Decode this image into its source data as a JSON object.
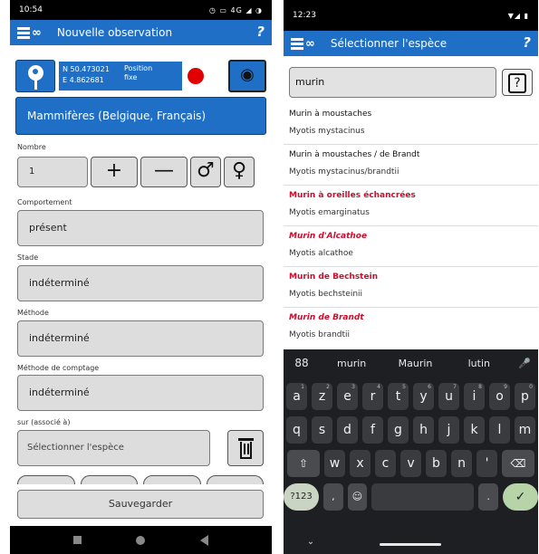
{
  "left": {
    "status": {
      "time": "10:54",
      "icons": "◷ ▭ 4G ◢ ◑"
    },
    "appbar": {
      "title": "Nouvelle observation",
      "help_label": "?"
    },
    "location": {
      "lat": "N 50.473021",
      "lon": "E 4.862681",
      "mode_line1": "Position",
      "mode_line2": "fixe",
      "map_icon": "◉"
    },
    "category": "Mammifères (Belgique, Français)",
    "count": {
      "label": "Nombre",
      "value": "1",
      "plus": "+",
      "minus": "—",
      "male": "♂",
      "female": "♀"
    },
    "fields": [
      {
        "label": "Comportement",
        "value": "présent"
      },
      {
        "label": "Stade",
        "value": "indéterminé"
      },
      {
        "label": "Méthode",
        "value": "indéterminé"
      },
      {
        "label": "Méthode de comptage",
        "value": "indéterminé"
      }
    ],
    "assoc": {
      "label": "sur (associé à)",
      "placeholder": "Sélectionner l'espèce"
    },
    "save_label": "Sauvegarder"
  },
  "right": {
    "status": {
      "time": "12:23",
      "icons": "▼◢ ▮"
    },
    "appbar": {
      "title": "Sélectionner l'espèce",
      "help_label": "?"
    },
    "search": {
      "value": "murin",
      "help_label": "?"
    },
    "species": [
      {
        "common": "Murin à moustaches",
        "latin": "Myotis mystacinus"
      },
      {
        "common": "Murin à moustaches / de Brandt",
        "latin": "Myotis mystacinus/brandtii"
      },
      {
        "common": "Murin à oreilles échancrées",
        "latin": "Myotis emarginatus"
      },
      {
        "common": "Murin d'Alcathoe",
        "latin": "Myotis alcathoe"
      },
      {
        "common": "Murin de Bechstein",
        "latin": "Myotis bechsteinii"
      },
      {
        "common": "Murin de Brandt",
        "latin": "Myotis brandtii"
      }
    ],
    "keyboard": {
      "suggestions": [
        "murin",
        "Maurin",
        "lutin"
      ],
      "grid_icon": "88",
      "mic_icon": "🎤",
      "row1": [
        "a",
        "z",
        "e",
        "r",
        "t",
        "y",
        "u",
        "i",
        "o",
        "p"
      ],
      "row1_hints": [
        "1",
        "2",
        "3",
        "4",
        "5",
        "6",
        "7",
        "8",
        "9",
        "0"
      ],
      "row2": [
        "q",
        "s",
        "d",
        "f",
        "g",
        "h",
        "j",
        "k",
        "l",
        "m"
      ],
      "row3": [
        "w",
        "x",
        "c",
        "v",
        "b",
        "n",
        "'"
      ],
      "shift_icon": "⇧",
      "backspace_icon": "⌫",
      "num_label": "?123",
      "comma": ",",
      "emoji_icon": "☺",
      "period": ".",
      "enter_icon": "✓",
      "hide_icon": "⌄"
    }
  }
}
